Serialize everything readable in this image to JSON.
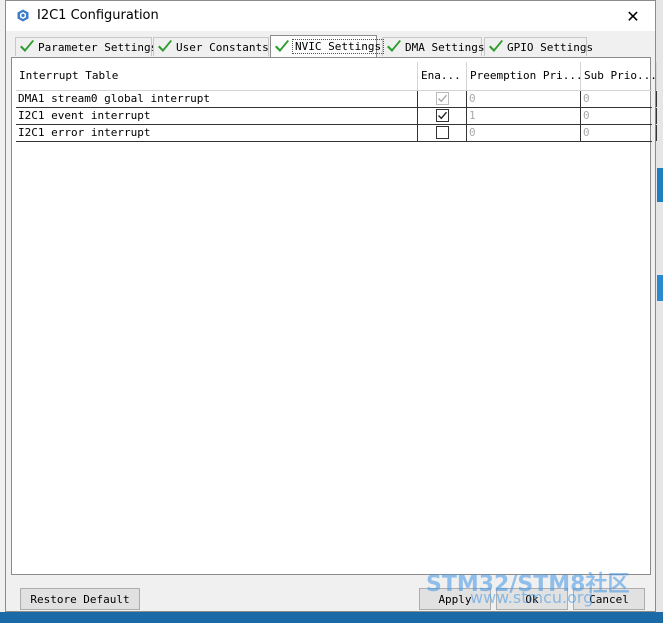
{
  "window": {
    "title": "I2C1 Configuration"
  },
  "tabs": [
    {
      "label": "Parameter Settings",
      "active": false
    },
    {
      "label": "User Constants",
      "active": false
    },
    {
      "label": "NVIC Settings",
      "active": true
    },
    {
      "label": "DMA Settings",
      "active": false
    },
    {
      "label": "GPIO Settings",
      "active": false
    }
  ],
  "table": {
    "headers": [
      "Interrupt Table",
      "Ena...",
      "Preemption Pri...",
      "Sub Prio..."
    ],
    "rows": [
      {
        "name": "DMA1 stream0 global interrupt",
        "enabled": true,
        "enabled_disabled": true,
        "preemption": "0",
        "sub": "0",
        "values_disabled": true
      },
      {
        "name": "I2C1 event interrupt",
        "enabled": true,
        "enabled_disabled": false,
        "preemption": "1",
        "sub": "0",
        "values_disabled": true
      },
      {
        "name": "I2C1 error interrupt",
        "enabled": false,
        "enabled_disabled": false,
        "preemption": "0",
        "sub": "0",
        "values_disabled": true
      }
    ]
  },
  "buttons": {
    "restore_default": "Restore Default",
    "apply": "Apply",
    "ok": "Ok",
    "cancel": "Cancel"
  },
  "watermark": {
    "line1": "STM32/STM8社区",
    "line2": "www.stmcu.org"
  },
  "colors": {
    "check_green": "#2e9c2e",
    "accent_blue": "#1e7fc0"
  }
}
